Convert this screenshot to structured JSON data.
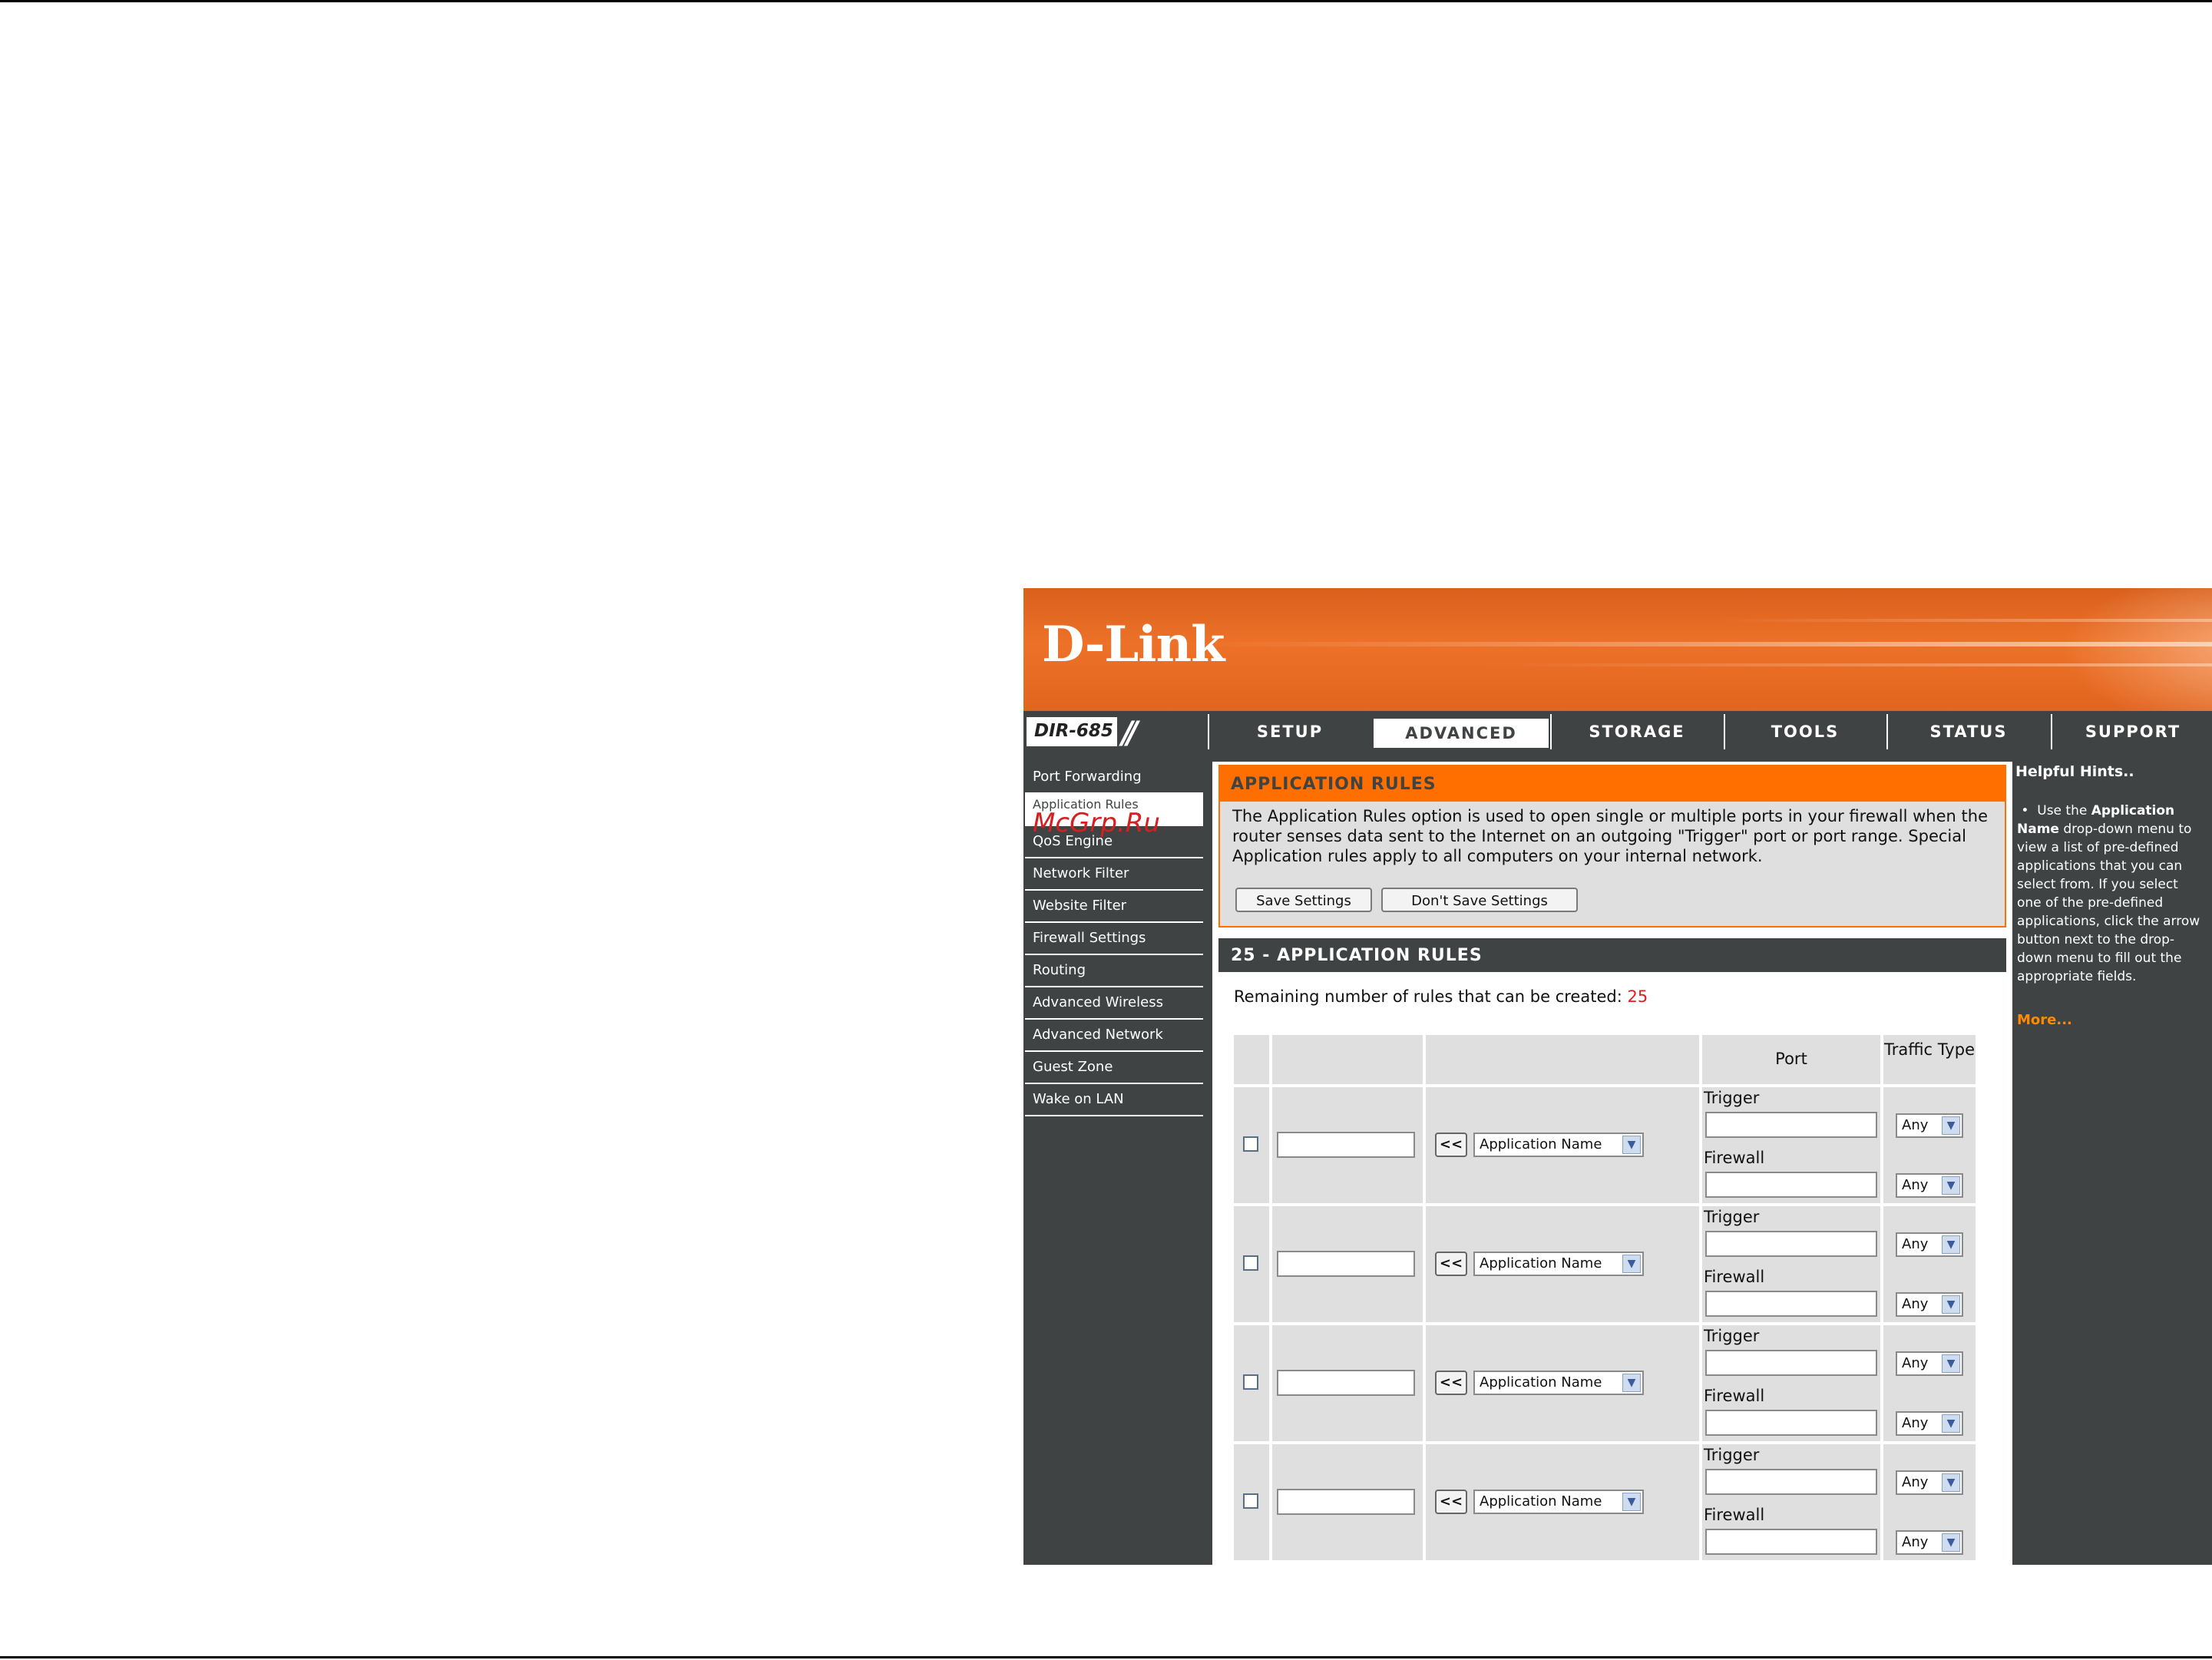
{
  "header": {
    "brand": "D-Link",
    "model": "DIR-685"
  },
  "nav": {
    "tabs": [
      {
        "label": "SETUP",
        "active": false
      },
      {
        "label": "ADVANCED",
        "active": true
      },
      {
        "label": "STORAGE",
        "active": false
      },
      {
        "label": "TOOLS",
        "active": false
      },
      {
        "label": "STATUS",
        "active": false
      },
      {
        "label": "SUPPORT",
        "active": false
      }
    ]
  },
  "sidebar": {
    "items": [
      {
        "label": "Port Forwarding",
        "active": false
      },
      {
        "label": "Application Rules",
        "active": true
      },
      {
        "label": "QoS Engine",
        "active": false
      },
      {
        "label": "Network Filter",
        "active": false
      },
      {
        "label": "Website Filter",
        "active": false
      },
      {
        "label": "Firewall Settings",
        "active": false
      },
      {
        "label": "Routing",
        "active": false
      },
      {
        "label": "Advanced Wireless",
        "active": false
      },
      {
        "label": "Advanced Network",
        "active": false
      },
      {
        "label": "Guest Zone",
        "active": false
      },
      {
        "label": "Wake on LAN",
        "active": false
      }
    ]
  },
  "watermark": "McGrp.Ru",
  "intro": {
    "title": "APPLICATION RULES",
    "text_lines": [
      "The Application Rules option is used to open single or multiple ports in your firewall when the",
      "router senses data sent to the Internet on an outgoing \"Trigger\" port or port range. Special",
      "Application rules apply to all computers on your internal network."
    ],
    "save_label": "Save Settings",
    "dont_save_label": "Don't Save Settings"
  },
  "rules": {
    "title": "25 - APPLICATION RULES",
    "remaining_label": "Remaining number of rules that can be created:",
    "remaining_value": "25",
    "col_port": "Port",
    "col_traffic": "Traffic Type",
    "rows": [
      {
        "name": "",
        "app_select": "Application Name",
        "arrow": "<<",
        "trigger_label": "Trigger",
        "firewall_label": "Firewall",
        "trigger_traffic": "Any",
        "firewall_traffic": "Any"
      },
      {
        "name": "",
        "app_select": "Application Name",
        "arrow": "<<",
        "trigger_label": "Trigger",
        "firewall_label": "Firewall",
        "trigger_traffic": "Any",
        "firewall_traffic": "Any"
      },
      {
        "name": "",
        "app_select": "Application Name",
        "arrow": "<<",
        "trigger_label": "Trigger",
        "firewall_label": "Firewall",
        "trigger_traffic": "Any",
        "firewall_traffic": "Any"
      },
      {
        "name": "",
        "app_select": "Application Name",
        "arrow": "<<",
        "trigger_label": "Trigger",
        "firewall_label": "Firewall",
        "trigger_traffic": "Any",
        "firewall_traffic": "Any"
      }
    ]
  },
  "hints": {
    "title": "Helpful Hints..",
    "bullet": "•",
    "text_pre": "Use the ",
    "text_bold": "Application Name",
    "text_post": " drop-down menu to view a list of pre-defined applications that you can select from. If you select one of the pre-defined applications, click the arrow button next to the drop-down menu to fill out the appropriate fields.",
    "more": "More..."
  },
  "colors": {
    "accent": "#ff6f00",
    "dark": "#404343",
    "panel": "#dfdfdf",
    "count": "#e02020"
  }
}
